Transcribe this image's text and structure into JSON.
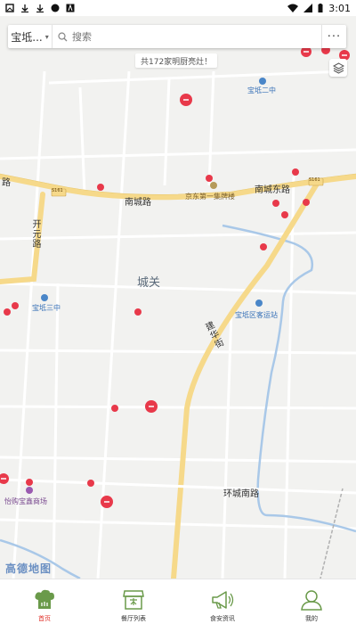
{
  "status_bar": {
    "time": "3:01"
  },
  "search": {
    "city": "宝坻...",
    "placeholder": "搜索",
    "more": "···"
  },
  "notice": "共172家明厨亮灶！",
  "map_labels": {
    "poi_school2": "宝坻二中",
    "poi_school3": "宝坻三中",
    "poi_jd": "京东第一集牌楼",
    "poi_bus": "宝坻区客运站",
    "poi_mall": "怡购宝鑫商场",
    "road_nancheng": "南城路",
    "road_nancheng_e": "南城东路",
    "road_kaiyuan": "开元路",
    "road_huanchengnan": "环城南路",
    "road_jianhua": "建华街",
    "road_code_s161": "S161",
    "district": "城关",
    "road_lu_left": "路",
    "amap": "高德地图"
  },
  "tabs": [
    {
      "label": "首页",
      "icon": "chef-hat-icon",
      "active": true
    },
    {
      "label": "餐厅列表",
      "icon": "shop-icon",
      "active": false
    },
    {
      "label": "食安资讯",
      "icon": "megaphone-icon",
      "active": false
    },
    {
      "label": "我的",
      "icon": "user-icon",
      "active": false
    }
  ],
  "colors": {
    "marker": "#e8394a",
    "active_tab": "#e0312a",
    "tab_icon": "#6a9a4a",
    "main_road": "#f6d98a",
    "water": "#a9c8e8"
  }
}
